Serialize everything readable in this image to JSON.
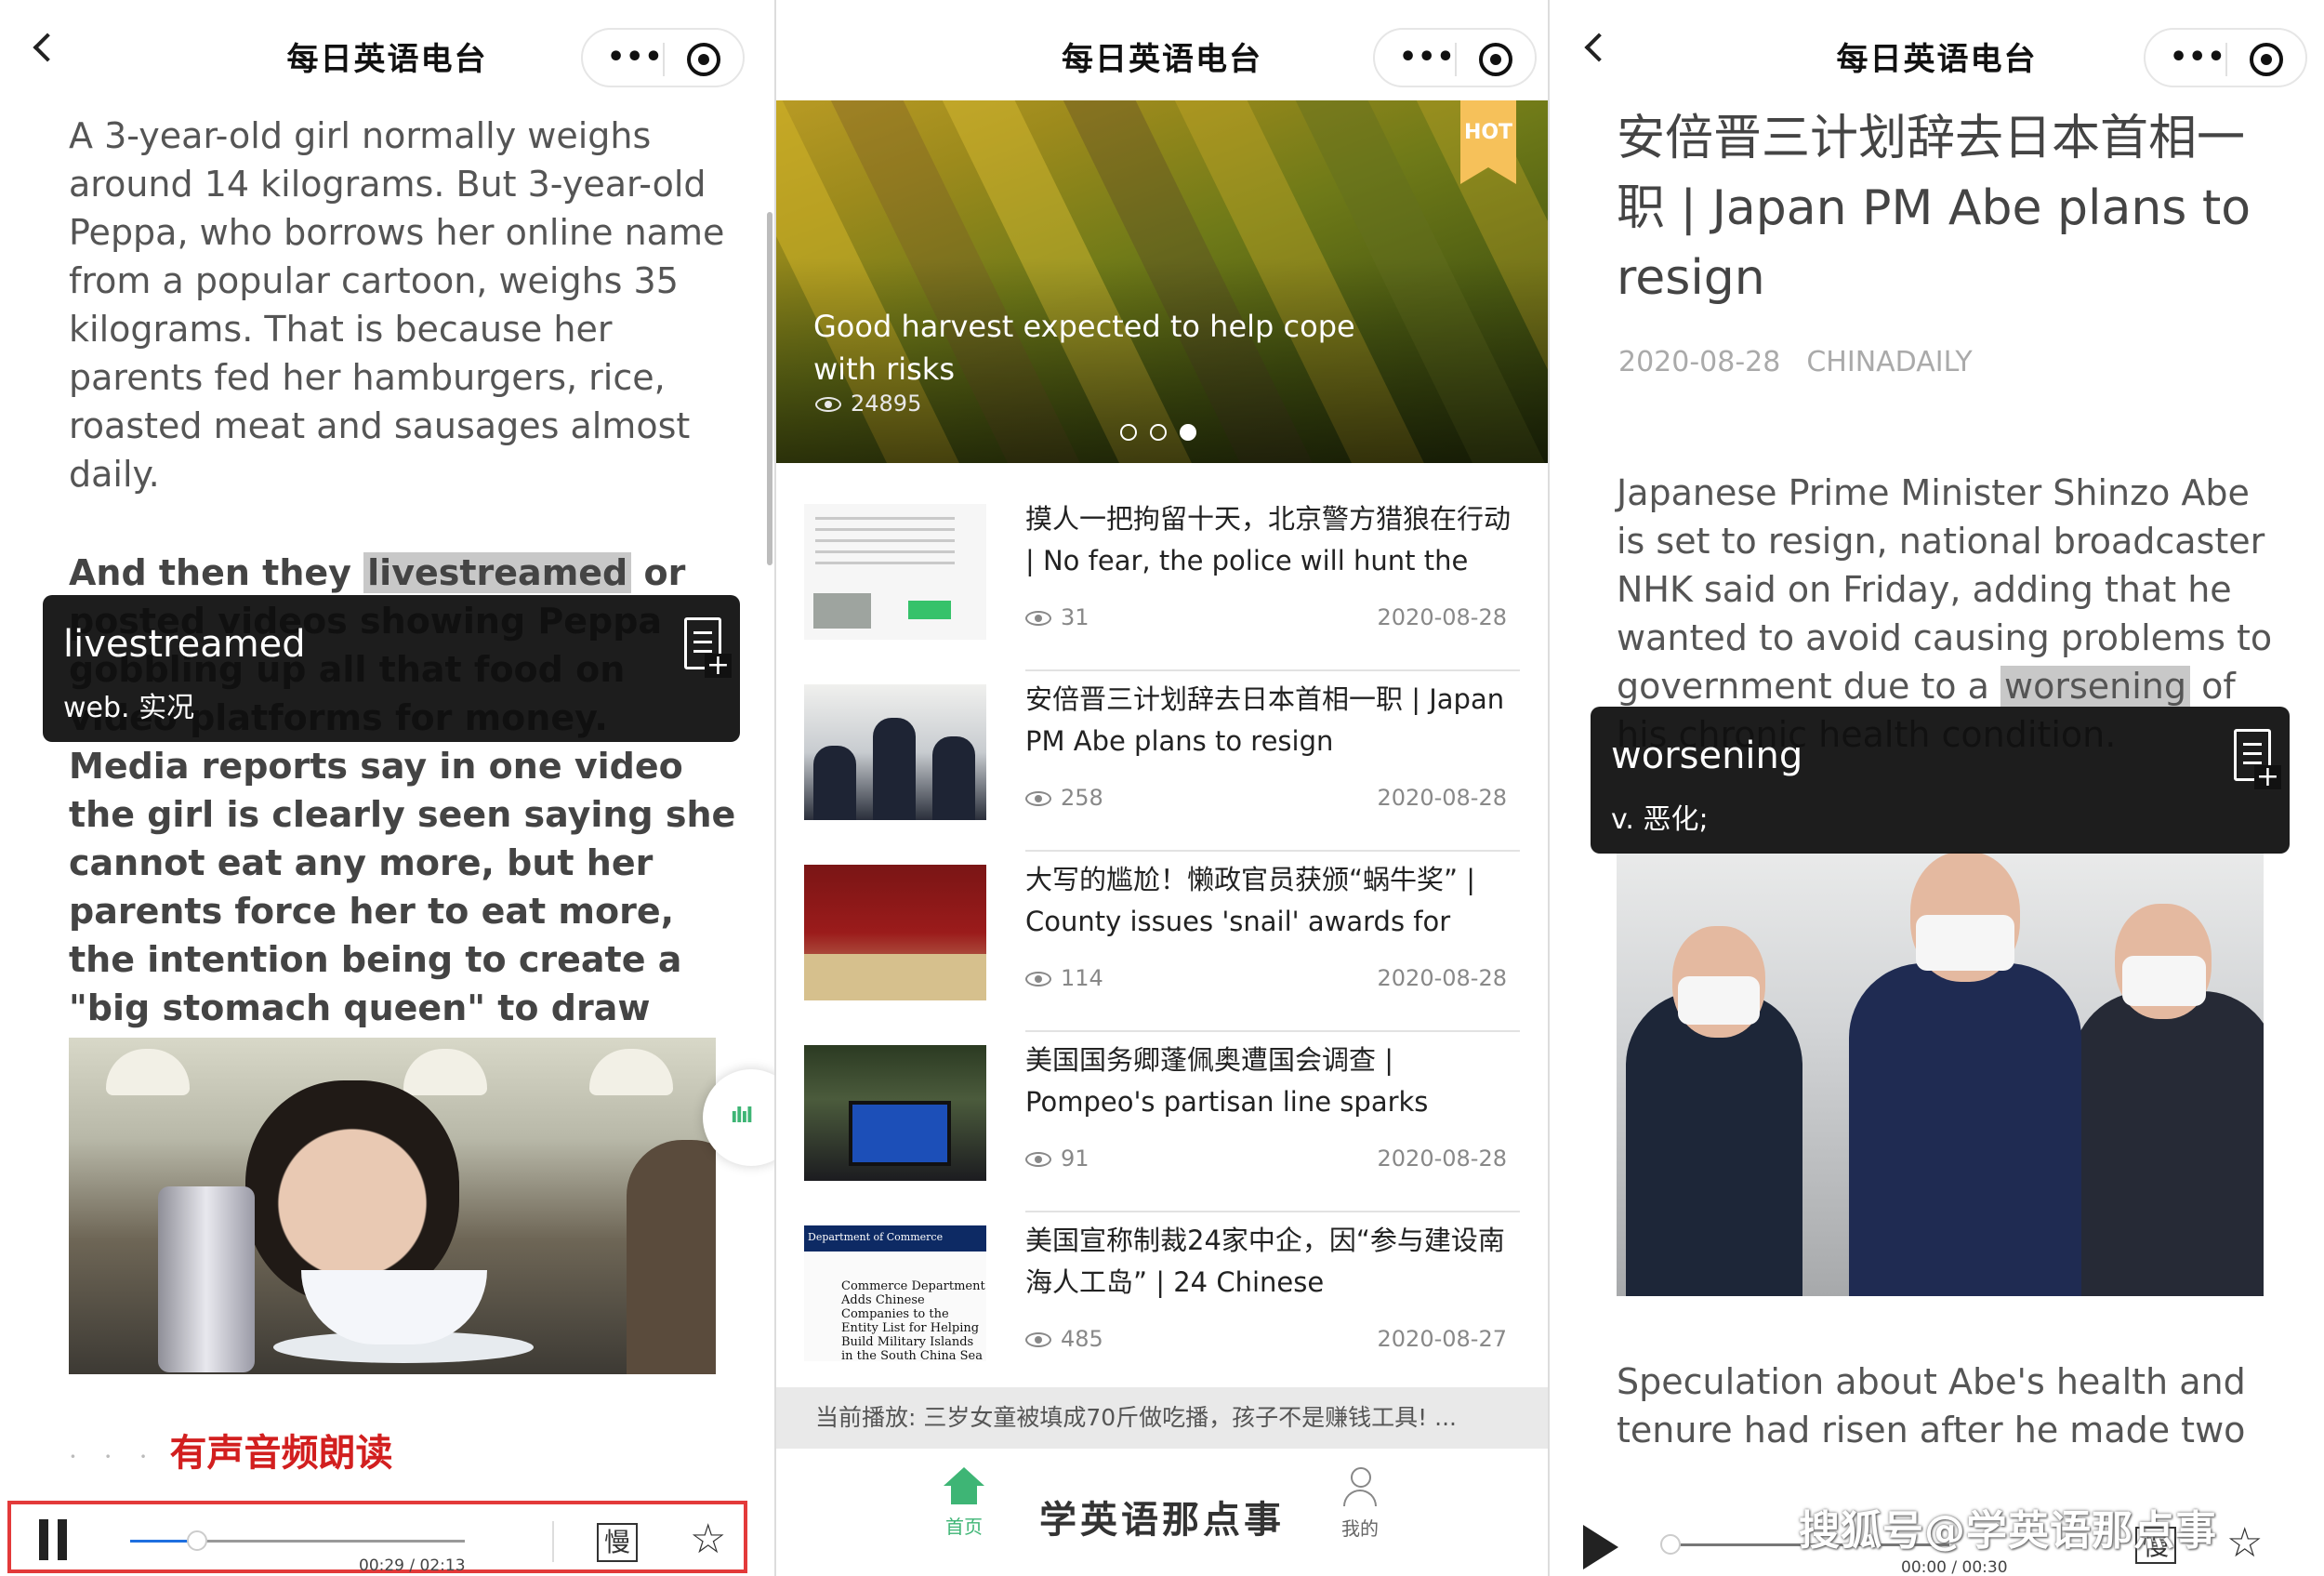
{
  "nav": {
    "title": "每日英语电台",
    "more": "•••"
  },
  "panel1": {
    "paragraph1": "A 3-year-old girl normally weighs around 14 kilograms. But 3-year-old Peppa, who borrows her online name from a popular cartoon, weighs 35 kilograms. That is because her parents fed her hamburgers, rice, roasted meat and sausages almost daily.",
    "paragraph2_before": "And then they ",
    "paragraph2_highlight": "livestreamed",
    "paragraph2_after": " or posted videos showing Peppa gobbling up all that food on video platforms for money. Media reports say in one video the girl is clearly seen saying she cannot eat any more, but her parents force her to eat more, the intention being to create a \"big stomach queen\" to draw eyeballs and bonuses from audiences.",
    "popup": {
      "word": "livestreamed",
      "definition": "web. 实况"
    },
    "audio_label": "有声音频朗读",
    "audio_dots": "· · ·",
    "player": {
      "elapsed": "00:29 / 02:13",
      "progress": 0.2,
      "slow_label": "慢"
    }
  },
  "panel2": {
    "banner": {
      "badge": "HOT",
      "title": "Good harvest expected to help cope with risks",
      "views": "24895",
      "active_dot": 2
    },
    "news": [
      {
        "title": "摸人一把拘留十天，北京警方猎狼在行动 | No fear, the police will hunt the",
        "views": "31",
        "date": "2020-08-28"
      },
      {
        "title": "安倍晋三计划辞去日本首相一职 | Japan PM Abe plans to resign",
        "views": "258",
        "date": "2020-08-28"
      },
      {
        "title": "大写的尴尬！懒政官员获颁“蜗牛奖” | County issues 'snail' awards for",
        "views": "114",
        "date": "2020-08-28"
      },
      {
        "title": "美国国务卿蓬佩奥遭国会调查 | Pompeo's partisan line sparks",
        "views": "91",
        "date": "2020-08-28"
      },
      {
        "title": "美国宣称制裁24家中企，因“参与建设南海人工岛” | 24 Chinese",
        "views": "485",
        "date": "2020-08-27"
      }
    ],
    "thumb5": {
      "header": "Department of Commerce",
      "text": "Commerce Department Adds Chinese Companies to the Entity List for Helping Build Military Islands in the South China Sea"
    },
    "now_playing": "当前播放: 三岁女童被填成70斤做吃播，孩子不是赚钱工具! ...",
    "tabs": {
      "home": "首页",
      "brand": "学英语那点事",
      "me": "我的"
    }
  },
  "panel3": {
    "title": "安倍晋三计划辞去日本首相一职 | Japan PM Abe plans to resign",
    "date": "2020-08-28",
    "source": "CHINADAILY",
    "body_before": "Japanese Prime Minister Shinzo Abe is set to resign, national broadcaster NHK said on Friday, adding that he wanted to avoid causing problems to government due to a ",
    "body_highlight": "worsening",
    "body_after": " of his chronic health condition.",
    "popup": {
      "word": "worsening",
      "definition": "v. 恶化;"
    },
    "body2": "Speculation about Abe's health and tenure had risen after he made two",
    "player": {
      "elapsed": "00:00 / 00:30",
      "progress": 0.0,
      "slow_label": "慢"
    }
  },
  "watermark": "搜狐号@学英语那点事",
  "colors": {
    "accent_green": "#3eb575",
    "highlight_red": "#d21f1f",
    "player_border": "#e33a3a",
    "hot_badge": "#f6c15a"
  }
}
